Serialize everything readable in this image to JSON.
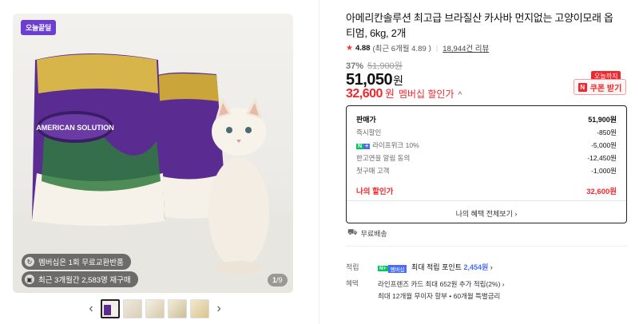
{
  "gallery": {
    "today_badge": "오늘끝딜",
    "pill_1": "멤버십은 1회 무료교환반품",
    "pill_2": "최근 3개월간 2,583명 재구매",
    "page_current": "1",
    "page_total": "/9",
    "bag_brand": "AMERICAN SOLUTION",
    "prev_icon": "chevron-left-icon",
    "next_icon": "chevron-right-icon"
  },
  "product": {
    "title": "아메리칸솔루션 최고급 브라질산 카사바 먼지없는 고양이모래 옵티멈, 6kg, 2개",
    "rating": "4.88",
    "rating_recent": "(최근 6개월 4.89",
    "reviews": "18,944건 리뷰",
    "discount_rate": "37%",
    "original_price": "51,900원",
    "price": "51,050",
    "price_unit": "원",
    "member_price": "32,600",
    "member_unit": "원",
    "member_label": "멤버십 할인가",
    "coupon_today": "오늘까지",
    "coupon_label": "쿠폰 받기"
  },
  "price_box": {
    "rows": [
      {
        "label": "판매가",
        "value": "51,900원"
      },
      {
        "label": "즉시할인",
        "value": "-850원"
      },
      {
        "label": "라이프위크 10%",
        "value": "-5,000원"
      },
      {
        "label": "한고연을 알림 동의",
        "value": "-12,450원"
      },
      {
        "label": "첫구매 고객",
        "value": "-1,000원"
      }
    ],
    "final_label": "나의 할인가",
    "final_value": "32,600원",
    "view_all": "나의 혜택 전체보기"
  },
  "delivery": {
    "label": "무료배송"
  },
  "points": {
    "label": "적립",
    "badge_n": "N+",
    "badge_m": "멤버십",
    "text": "최대 적립 포인트",
    "amount": "2,454원"
  },
  "benefits": {
    "label": "혜택",
    "line_1": "라인프렌즈 카드 최대 652원 추가 적립(2%)",
    "line_2": "최대 12개월 무이자 할부 • 60개월 특별금리"
  },
  "colors": {
    "accent_red": "#f0282d",
    "badge_purple": "#6b3fd4",
    "naver_green": "#03c75a",
    "membership_blue": "#4a6cf7"
  }
}
